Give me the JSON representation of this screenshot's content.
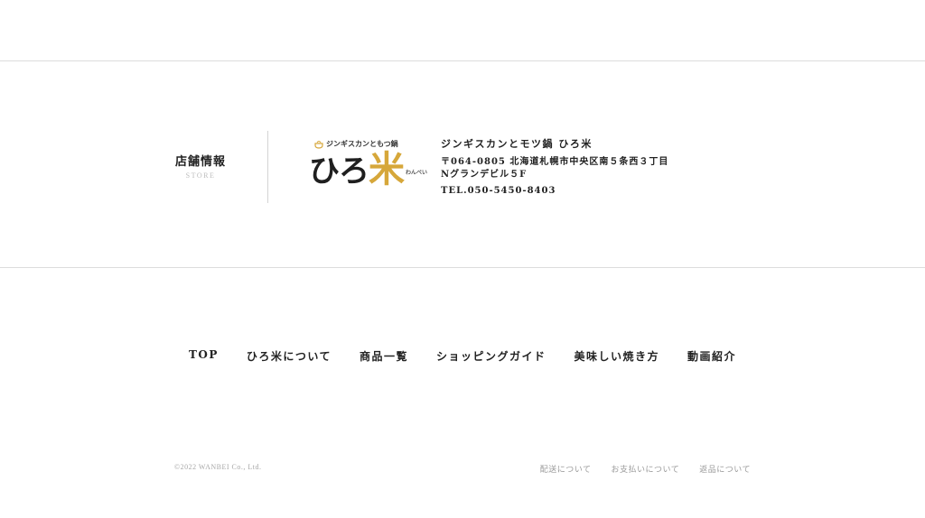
{
  "store": {
    "heading_ja": "店舗情報",
    "heading_en": "STORE",
    "logo": {
      "tagline": "ジンギスカンともつ鍋",
      "brand_hira": "ひろ",
      "brand_kome": "米",
      "brand_sub": "わんべい",
      "pot_icon": "hot-pot-icon"
    },
    "name": "ジンギスカンとモツ鍋 ひろ米",
    "address_line1": "〒064-0805 北海道札幌市中央区南５条西３丁目",
    "address_line2": "Nグランデビル５F",
    "tel": "TEL.050-5450-8403"
  },
  "nav": {
    "items": [
      {
        "label": "TOP"
      },
      {
        "label": "ひろ米について"
      },
      {
        "label": "商品一覧"
      },
      {
        "label": "ショッピングガイド"
      },
      {
        "label": "美味しい焼き方"
      },
      {
        "label": "動画紹介"
      }
    ]
  },
  "footer": {
    "copyright": "©2022 WANBEI Co., Ltd.",
    "links": [
      {
        "label": "配送について"
      },
      {
        "label": "お支払いについて"
      },
      {
        "label": "返品について"
      }
    ]
  },
  "colors": {
    "accent_gold": "#d6a73a",
    "divider": "#dcdcdc",
    "text": "#222222",
    "muted": "#999999"
  }
}
